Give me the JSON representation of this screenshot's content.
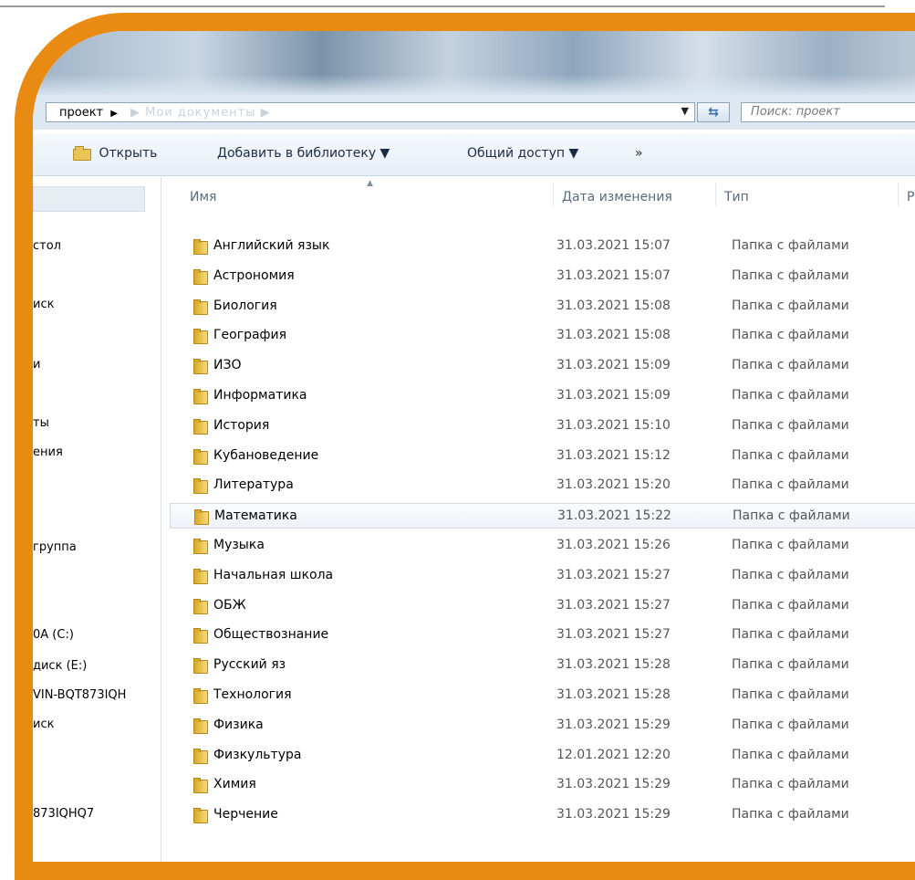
{
  "address": {
    "path": "проект",
    "path_sep": "▶",
    "faded": "▶  Мои документы  ▶",
    "dropdown": "▼"
  },
  "nav": {
    "back_forward": "⇆"
  },
  "search": {
    "placeholder": "Поиск: проект"
  },
  "toolbar": {
    "open_label": "Открыть",
    "add_library_label": "Добавить в библиотеку ▼",
    "share_label": "Общий доступ ▼",
    "more_label": "»"
  },
  "sidebar": {
    "items": [
      "стол",
      "иск",
      "и",
      "ты",
      "ения",
      "группа",
      "",
      "0A (C:)",
      "диск (E:)",
      "VIN-BQT873IQH",
      "иск",
      "873IQHQ7"
    ]
  },
  "columns": {
    "name": "Имя",
    "date": "Дата изменения",
    "type": "Тип",
    "size": "Раз"
  },
  "files": [
    {
      "name": "Английский язык",
      "date": "31.03.2021 15:07",
      "type": "Папка с файлами"
    },
    {
      "name": "Астрономия",
      "date": "31.03.2021 15:07",
      "type": "Папка с файлами"
    },
    {
      "name": "Биология",
      "date": "31.03.2021 15:08",
      "type": "Папка с файлами"
    },
    {
      "name": "География",
      "date": "31.03.2021 15:08",
      "type": "Папка с файлами"
    },
    {
      "name": "ИЗО",
      "date": "31.03.2021 15:09",
      "type": "Папка с файлами"
    },
    {
      "name": "Информатика",
      "date": "31.03.2021 15:09",
      "type": "Папка с файлами"
    },
    {
      "name": "История",
      "date": "31.03.2021 15:10",
      "type": "Папка с файлами"
    },
    {
      "name": "Кубановедение",
      "date": "31.03.2021 15:12",
      "type": "Папка с файлами"
    },
    {
      "name": "Литература",
      "date": "31.03.2021 15:20",
      "type": "Папка с файлами"
    },
    {
      "name": "Математика",
      "date": "31.03.2021 15:22",
      "type": "Папка с файлами"
    },
    {
      "name": "Музыка",
      "date": "31.03.2021 15:26",
      "type": "Папка с файлами"
    },
    {
      "name": "Начальная школа",
      "date": "31.03.2021 15:27",
      "type": "Папка с файлами"
    },
    {
      "name": "ОБЖ",
      "date": "31.03.2021 15:27",
      "type": "Папка с файлами"
    },
    {
      "name": "Обществознание",
      "date": "31.03.2021 15:27",
      "type": "Папка с файлами"
    },
    {
      "name": "Русский яз",
      "date": "31.03.2021 15:28",
      "type": "Папка с файлами"
    },
    {
      "name": "Технология",
      "date": "31.03.2021 15:28",
      "type": "Папка с файлами"
    },
    {
      "name": "Физика",
      "date": "31.03.2021 15:29",
      "type": "Папка с файлами"
    },
    {
      "name": "Физкультура",
      "date": "12.01.2021 12:20",
      "type": "Папка с файлами"
    },
    {
      "name": "Химия",
      "date": "31.03.2021 15:29",
      "type": "Папка с файлами"
    },
    {
      "name": "Черчение",
      "date": "31.03.2021 15:29",
      "type": "Папка с файлами"
    }
  ],
  "selected_index": 9,
  "colors": {
    "frame": "#e98a12",
    "folder": "#e8c45a",
    "toolbar_bg": "#e6eef6"
  }
}
